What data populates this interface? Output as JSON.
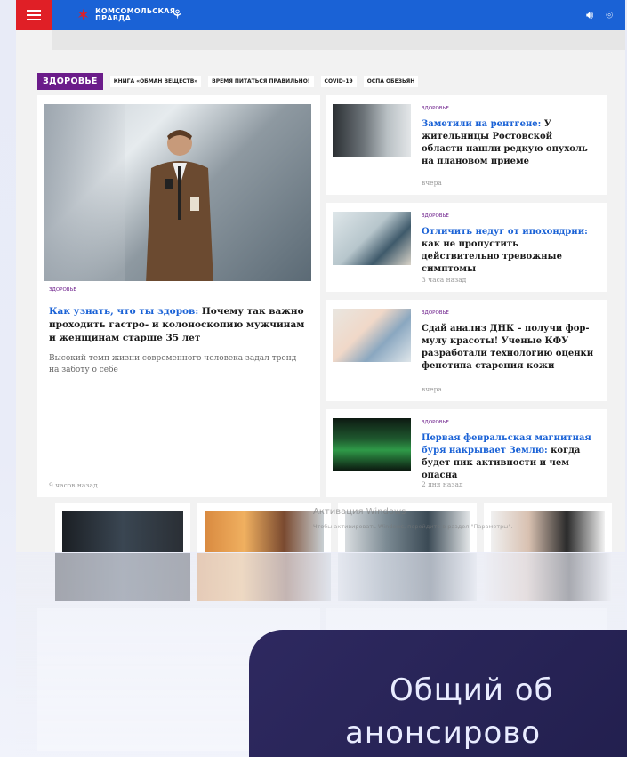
{
  "header": {
    "logo_line1": "КОМСОМОЛЬСКАЯ",
    "logo_line2": "ПРАВДА",
    "menu_icon": "hamburger-icon",
    "sound_icon": "speaker-icon",
    "location_icon": "location-pin-icon"
  },
  "rubric": {
    "title": "ЗДОРОВЬЕ",
    "tags": [
      "КНИГА «ОБМАН ВЕЩЕСТВ»",
      "ВРЕМЯ ПИТАТЬСЯ ПРАВИЛЬНО!",
      "COVID-19",
      "ОСПА ОБЕЗЬЯН"
    ]
  },
  "main_article": {
    "tag": "ЗДОРОВЬЕ",
    "title_lead": "Как узнать, что ты здоров:",
    "title_rest": " Почему так важно про­ходить гастро- и колоноскопию мужчинам и жен­щинам старше 35 лет",
    "desc": "Высокий темп жизни современного человека задал тренд на заботу о себе",
    "time": "9 часов назад"
  },
  "side_articles": [
    {
      "tag": "ЗДОРОВЬЕ",
      "title_lead": "Заметили на рентгене:",
      "title_rest": " У житель­ницы Ростовской области нашли редкую опухоль на плановом приеме",
      "time": "вчера"
    },
    {
      "tag": "ЗДОРОВЬЕ",
      "title_lead": "Отличить недуг от ипохондрии:",
      "title_rest": " как не пропустить действительно тревожные симптомы",
      "time": "3 часа назад"
    },
    {
      "tag": "ЗДОРОВЬЕ",
      "title_lead": "",
      "title_rest": "Сдай анализ ДНК – получи фор­мулу красоты! Ученые КФУ разра­ботали технологию оценки фено­типа старения кожи",
      "time": "вчера"
    },
    {
      "tag": "ЗДОРОВЬЕ",
      "title_lead": "Первая февральская магнитная буря накрывает Землю:",
      "title_rest": " когда бу­дет пик активности и чем опасна",
      "time": "2 дня назад"
    }
  ],
  "windows_watermark": {
    "title": "Активация Windows",
    "subtitle": "Чтобы активировать Windows, перейдите в раздел \"Параметры\"."
  },
  "banner": {
    "line1": "Общий об",
    "line2": "анонсирово"
  }
}
